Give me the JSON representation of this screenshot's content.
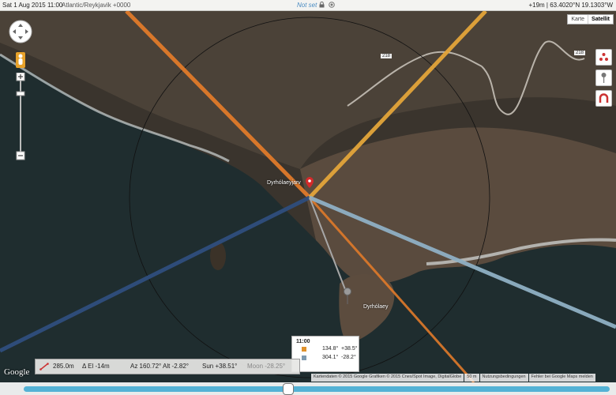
{
  "topbar": {
    "datetime": "Sat 1 Aug 2015 11:00",
    "timezone": "Atlantic/Reykjavik +0000",
    "notset": "Not set",
    "coords": "+19m | 63.4020°N 19.1303°W"
  },
  "maptype": {
    "map": "Karte",
    "satellite": "Satellit"
  },
  "map_labels": {
    "marker1": "Dyrhólaeyjarv",
    "marker2": "Dyrhólaey",
    "road1": "218",
    "road2": "218"
  },
  "infobox": {
    "time": "11:00",
    "rows": [
      {
        "az": "134.8°",
        "alt": "+38.5°",
        "color": "#e0922c"
      },
      {
        "az": "304.1°",
        "alt": "-28.2°",
        "color": "#7e9ab0"
      }
    ]
  },
  "status": {
    "distance": "285.0m",
    "delta_el": "Δ El  -14m",
    "az": "Az 160.72°",
    "alt": "Alt  -2.82°",
    "sun": "Sun +38.51°",
    "moon": "Moon -28.25°"
  },
  "attribution": {
    "data": "Kartendaten © 2015 Google Grafiken © 2015 Cnes/Spot Image, DigitalGlobe",
    "scale": "50 m",
    "terms": "Nutzungsbedingungen",
    "report": "Fehler bei Google Maps melden"
  },
  "google_logo": "Google",
  "colors": {
    "sunrise": "#e07a2a",
    "sunset": "#e3a53a",
    "moonrise": "#2f4e7e",
    "moonset": "#8fb0c4",
    "slider": "#54b2d5"
  },
  "icons": [
    "navigation-pad-icon",
    "pegman-icon",
    "zoom-in-icon",
    "zoom-out-icon",
    "lock-icon",
    "eye-icon",
    "layers-icon",
    "pin-icon",
    "magnet-icon",
    "location-pin-icon",
    "camera-icon"
  ]
}
